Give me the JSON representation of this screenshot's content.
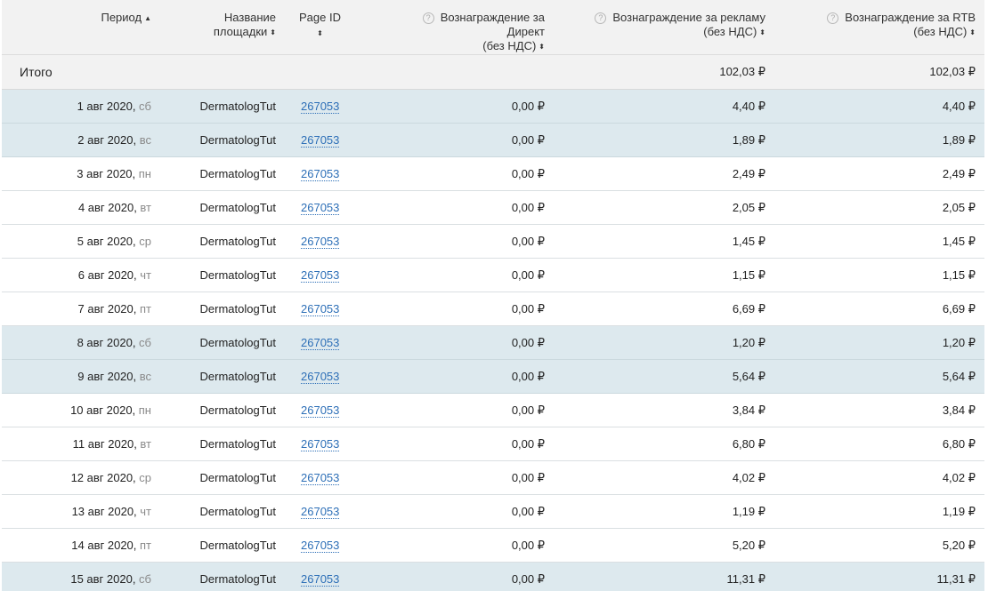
{
  "header": {
    "period": "Период",
    "site_name_1": "Название",
    "site_name_2": "площадки",
    "page_id": "Page ID",
    "direct_1": "Вознаграждение за Директ",
    "direct_2": "(без НДС)",
    "ads_1": "Вознаграждение за рекламу",
    "ads_2": "(без НДС)",
    "rtb_1": "Вознаграждение за RTB",
    "rtb_2": "(без НДС)",
    "help_glyph": "?",
    "sort_asc_glyph": "▲",
    "sort_both_glyph": "⬍"
  },
  "total": {
    "label": "Итого",
    "direct": "",
    "ads": "102,03 ₽",
    "rtb": "102,03 ₽"
  },
  "rows": [
    {
      "date": "1 авг 2020,",
      "dow": " сб",
      "name": "DermatologTut",
      "page_id": "267053",
      "direct": "0,00 ₽",
      "ads": "4,40 ₽",
      "rtb": "4,40 ₽",
      "weekend": true
    },
    {
      "date": "2 авг 2020,",
      "dow": " вс",
      "name": "DermatologTut",
      "page_id": "267053",
      "direct": "0,00 ₽",
      "ads": "1,89 ₽",
      "rtb": "1,89 ₽",
      "weekend": true
    },
    {
      "date": "3 авг 2020,",
      "dow": " пн",
      "name": "DermatologTut",
      "page_id": "267053",
      "direct": "0,00 ₽",
      "ads": "2,49 ₽",
      "rtb": "2,49 ₽",
      "weekend": false
    },
    {
      "date": "4 авг 2020,",
      "dow": " вт",
      "name": "DermatologTut",
      "page_id": "267053",
      "direct": "0,00 ₽",
      "ads": "2,05 ₽",
      "rtb": "2,05 ₽",
      "weekend": false
    },
    {
      "date": "5 авг 2020,",
      "dow": " ср",
      "name": "DermatologTut",
      "page_id": "267053",
      "direct": "0,00 ₽",
      "ads": "1,45 ₽",
      "rtb": "1,45 ₽",
      "weekend": false
    },
    {
      "date": "6 авг 2020,",
      "dow": " чт",
      "name": "DermatologTut",
      "page_id": "267053",
      "direct": "0,00 ₽",
      "ads": "1,15 ₽",
      "rtb": "1,15 ₽",
      "weekend": false
    },
    {
      "date": "7 авг 2020,",
      "dow": " пт",
      "name": "DermatologTut",
      "page_id": "267053",
      "direct": "0,00 ₽",
      "ads": "6,69 ₽",
      "rtb": "6,69 ₽",
      "weekend": false
    },
    {
      "date": "8 авг 2020,",
      "dow": " сб",
      "name": "DermatologTut",
      "page_id": "267053",
      "direct": "0,00 ₽",
      "ads": "1,20 ₽",
      "rtb": "1,20 ₽",
      "weekend": true
    },
    {
      "date": "9 авг 2020,",
      "dow": " вс",
      "name": "DermatologTut",
      "page_id": "267053",
      "direct": "0,00 ₽",
      "ads": "5,64 ₽",
      "rtb": "5,64 ₽",
      "weekend": true
    },
    {
      "date": "10 авг 2020,",
      "dow": " пн",
      "name": "DermatologTut",
      "page_id": "267053",
      "direct": "0,00 ₽",
      "ads": "3,84 ₽",
      "rtb": "3,84 ₽",
      "weekend": false
    },
    {
      "date": "11 авг 2020,",
      "dow": " вт",
      "name": "DermatologTut",
      "page_id": "267053",
      "direct": "0,00 ₽",
      "ads": "6,80 ₽",
      "rtb": "6,80 ₽",
      "weekend": false
    },
    {
      "date": "12 авг 2020,",
      "dow": " ср",
      "name": "DermatologTut",
      "page_id": "267053",
      "direct": "0,00 ₽",
      "ads": "4,02 ₽",
      "rtb": "4,02 ₽",
      "weekend": false
    },
    {
      "date": "13 авг 2020,",
      "dow": " чт",
      "name": "DermatologTut",
      "page_id": "267053",
      "direct": "0,00 ₽",
      "ads": "1,19 ₽",
      "rtb": "1,19 ₽",
      "weekend": false
    },
    {
      "date": "14 авг 2020,",
      "dow": " пт",
      "name": "DermatologTut",
      "page_id": "267053",
      "direct": "0,00 ₽",
      "ads": "5,20 ₽",
      "rtb": "5,20 ₽",
      "weekend": false
    },
    {
      "date": "15 авг 2020,",
      "dow": " сб",
      "name": "DermatologTut",
      "page_id": "267053",
      "direct": "0,00 ₽",
      "ads": "11,31 ₽",
      "rtb": "11,31 ₽",
      "weekend": true
    }
  ],
  "colors": {
    "header_bg": "#f2f2f2",
    "weekend_bg": "#dde9ee",
    "link": "#2d6fb7",
    "weekday_text": "#8a8a8a"
  }
}
